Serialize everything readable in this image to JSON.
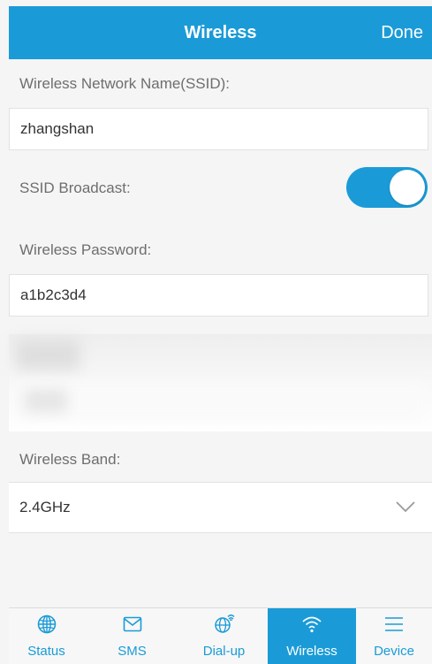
{
  "header": {
    "title": "Wireless",
    "done_label": "Done"
  },
  "form": {
    "ssid_label": "Wireless Network Name(SSID):",
    "ssid_value": "zhangshan",
    "broadcast_label": "SSID Broadcast:",
    "broadcast_on": true,
    "password_label": "Wireless Password:",
    "password_value": "a1b2c3d4",
    "band_label": "Wireless Band:",
    "band_value": "2.4GHz"
  },
  "tabs": [
    {
      "label": "Status",
      "icon": "globe-icon"
    },
    {
      "label": "SMS",
      "icon": "envelope-icon"
    },
    {
      "label": "Dial-up",
      "icon": "globe-signal-icon"
    },
    {
      "label": "Wireless",
      "icon": "wifi-icon",
      "active": true
    },
    {
      "label": "Device",
      "icon": "menu-icon"
    }
  ],
  "colors": {
    "accent": "#1a9bd7",
    "background": "#f5f5f5"
  }
}
